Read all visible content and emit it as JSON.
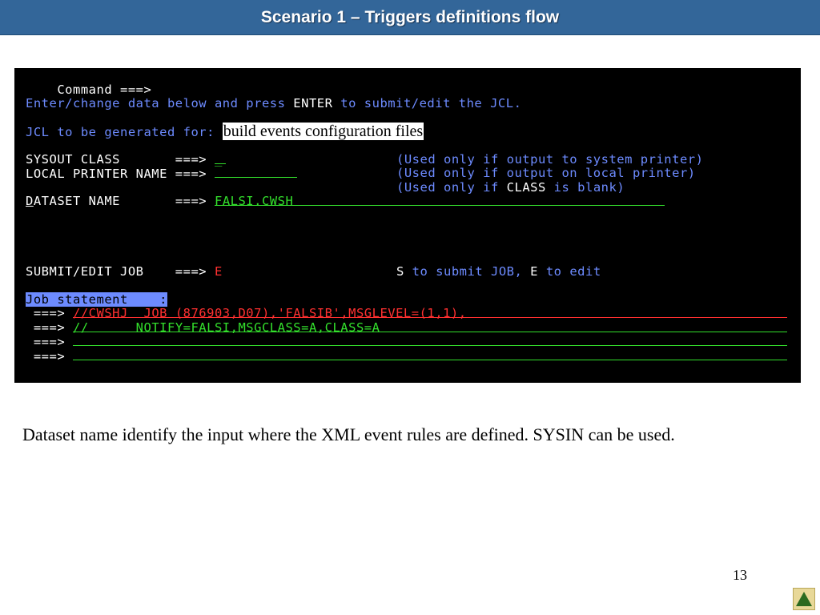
{
  "slide": {
    "title": "Scenario 1 – Triggers definitions flow",
    "caption": "Dataset name identify the input where the XML event rules are defined. SYSIN can be used.",
    "page_number": "13",
    "nav_up_icon": "up-triangle-icon"
  },
  "terminal": {
    "command_label": "Command ===>",
    "instructions": {
      "p1": "Enter/change data below and press ",
      "enter_key": "ENTER",
      "p2": " to submit/edit the JCL."
    },
    "jcl_for_label": "JCL to be generated for: ",
    "jcl_for_value": "build events configuration files",
    "sysout": {
      "label": "SYSOUT CLASS       ===> ",
      "value": "_",
      "note": "(Used only if output to system printer)"
    },
    "local_printer": {
      "label": "LOCAL PRINTER NAME ===> ",
      "value": "",
      "note": "(Used only if output on local printer)"
    },
    "class_note": {
      "p1": "(Used only if ",
      "class_word": "CLASS",
      "p2": " is blank)"
    },
    "dataset": {
      "first_letter": "D",
      "label_rest": "ATASET NAME       ===> ",
      "value": "FALSI.CWSH"
    },
    "submit": {
      "label": "SUBMIT/EDIT JOB    ===> ",
      "value": "E",
      "hint_s": "S",
      "hint_s_text": " to submit JOB, ",
      "hint_e": "E",
      "hint_e_text": " to edit"
    },
    "job_statement": {
      "label": "Job statement    :",
      "prompt": " ===> ",
      "lines": [
        "//CWSHJ  JOB (876903,D07),'FALSIB',MSGLEVEL=(1,1),",
        "//      NOTIFY=FALSI,MSGCLASS=A,CLASS=A",
        "",
        ""
      ]
    },
    "colors": {
      "background": "#000000",
      "text_white": "#ffffff",
      "text_blue": "#6d8bff",
      "text_green": "#33e02c",
      "text_red": "#ff3030"
    }
  }
}
